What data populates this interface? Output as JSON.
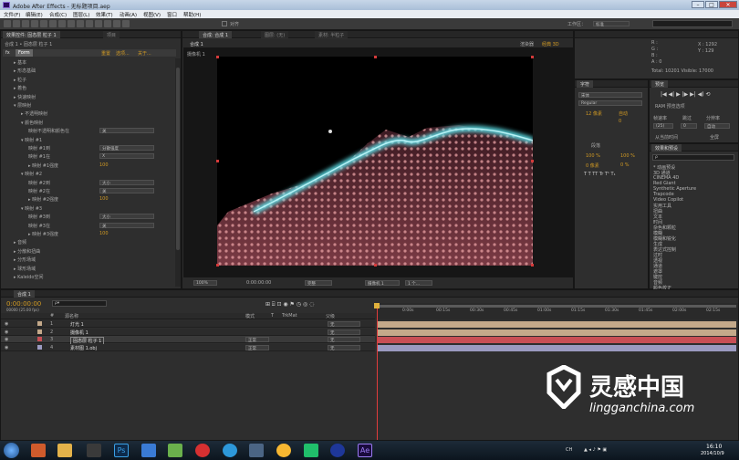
{
  "app": {
    "title": "Adobe After Effects - 无标题项目.aep",
    "window_buttons": [
      "–",
      "□",
      "✕"
    ]
  },
  "menu": [
    "文件(F)",
    "编辑(E)",
    "合成(C)",
    "图层(L)",
    "效果(T)",
    "动画(A)",
    "视图(V)",
    "窗口",
    "帮助(H)"
  ],
  "toolbar": {
    "snap_label": "对齐",
    "workspace_label": "工作区：",
    "workspace_value": "标准"
  },
  "effect_controls": {
    "tabs": [
      "效果控件: 固态层 粒子 1",
      "项目"
    ],
    "path_label": "合成 1 • 固态层 粒子 1",
    "fx_name": "Form",
    "fx_links": [
      "重置",
      "选项...",
      "关于..."
    ],
    "rows": [
      {
        "label": "▸ 基本",
        "indent": 1
      },
      {
        "label": "▸ 形态基础",
        "indent": 1
      },
      {
        "label": "▸ 粒子",
        "indent": 1
      },
      {
        "label": "▸ 着色",
        "indent": 1
      },
      {
        "label": "▸ 快速映射",
        "indent": 1
      },
      {
        "label": "▾ 层映射",
        "indent": 1
      },
      {
        "label": "▸ 不透明映射",
        "indent": 2
      },
      {
        "label": "▾ 颜色映射",
        "indent": 2
      },
      {
        "label": "映射不透明和颜色在",
        "indent": 3,
        "dd": "关"
      },
      {
        "label": "▾ 映射 #1",
        "indent": 2
      },
      {
        "label": "映射 #1到",
        "indent": 3,
        "dd": "分散强度"
      },
      {
        "label": "映射 #1在",
        "indent": 3,
        "dd": "X"
      },
      {
        "label": "▸ 映射 #1强度",
        "indent": 3,
        "val": "100"
      },
      {
        "label": "▾ 映射 #2",
        "indent": 2
      },
      {
        "label": "映射 #2到",
        "indent": 3,
        "dd": "大小"
      },
      {
        "label": "映射 #2在",
        "indent": 3,
        "dd": "关"
      },
      {
        "label": "▸ 映射 #2强度",
        "indent": 3,
        "val": "100"
      },
      {
        "label": "▾ 映射 #3",
        "indent": 2
      },
      {
        "label": "映射 #3到",
        "indent": 3,
        "dd": "大小"
      },
      {
        "label": "映射 #3在",
        "indent": 3,
        "dd": "关"
      },
      {
        "label": "▸ 映射 #3强度",
        "indent": 3,
        "val": "100"
      },
      {
        "label": "▸ 音频",
        "indent": 1
      },
      {
        "label": "▸ 分散和扭曲",
        "indent": 1
      },
      {
        "label": "▸ 分形场域",
        "indent": 1
      },
      {
        "label": "▸ 球形场域",
        "indent": 1
      },
      {
        "label": "▸ Kaleido空间",
        "indent": 1
      }
    ]
  },
  "composition": {
    "tabs": [
      "合成: 合成 1",
      "图层: (无)",
      "素材: 半粒子"
    ],
    "sub_tab": "合成 1",
    "view_label": "渲染器",
    "view_value": "经典 3D",
    "camera_label": "摄像机 1",
    "footer": {
      "zoom": "100%",
      "time": "0:00:00:00",
      "quality": "完整",
      "camera": "摄像机 1",
      "views": "1 个..."
    }
  },
  "info_panel": {
    "values": [
      "R :",
      "G :",
      "B :",
      "A : 0"
    ],
    "xy": [
      "X : 1292",
      "Y : 129"
    ],
    "total": "Total: 10201   Visible: 17000"
  },
  "character_panel": {
    "tab": "字符",
    "font": "宋体",
    "style": "Regular",
    "size": "12 像素",
    "leading": "自动",
    "tracking": "0",
    "scale_v": "100 %",
    "scale_h": "100 %",
    "baseline": "0 像素",
    "tsume": "0 %",
    "para_tab": "段落"
  },
  "preview_panel": {
    "tab": "预览",
    "ram_label": "RAM 预览选项",
    "fps_label": "帧速率",
    "skip_label": "跳过",
    "res_label": "分辨率",
    "fps_value": "(25)",
    "skip_value": "0",
    "res_value": "自动",
    "from_label": "从当前时间",
    "full_label": "全屏"
  },
  "effects_presets": {
    "tab": "效果和预设",
    "search_placeholder": "ρ",
    "items": [
      "* 动画预设",
      "3D 通道",
      "CINEMA 4D",
      "Red Giant",
      "Synthetic Aperture",
      "Trapcode",
      "Video Copilot",
      "实用工具",
      "扭曲",
      "文本",
      "时间",
      "杂色和颗粒",
      "模糊",
      "模糊和锐化",
      "生成",
      "表达式控制",
      "过时",
      "透视",
      "通道",
      "遮罩",
      "键控",
      "音频",
      "颜色校正",
      "风格化"
    ]
  },
  "timeline": {
    "tab": "合成 1",
    "timecode": "0:00:00:00",
    "frame_info": "00000 (25.00 fps)",
    "search_placeholder": "ρ▾",
    "headers": [
      "#",
      "源名称",
      "模式",
      "T",
      "TrkMat",
      "父级"
    ],
    "ruler": [
      "0:00s",
      "00:15s",
      "00:30s",
      "00:45s",
      "01:00s",
      "01:15s",
      "01:30s",
      "01:45s",
      "02:00s",
      "02:15s",
      "02:30s"
    ],
    "layers": [
      {
        "num": "1",
        "name": "灯光 1",
        "mode": "",
        "parent": "无",
        "color": "#c4a98a"
      },
      {
        "num": "2",
        "name": "摄像机 1",
        "mode": "",
        "parent": "无",
        "color": "#c4a98a"
      },
      {
        "num": "3",
        "name": "固态层 粒子 1",
        "mode": "正常",
        "parent": "无",
        "color": "#c84f55"
      },
      {
        "num": "4",
        "name": "素材图 1.obj",
        "mode": "正常",
        "parent": "无",
        "color": "#9b9ac0"
      }
    ]
  },
  "taskbar": {
    "time": "16:10",
    "date": "2014/10/9",
    "tray_text": "CH"
  },
  "watermark": {
    "brand": "灵感中国",
    "url": "lingganchina.com"
  }
}
